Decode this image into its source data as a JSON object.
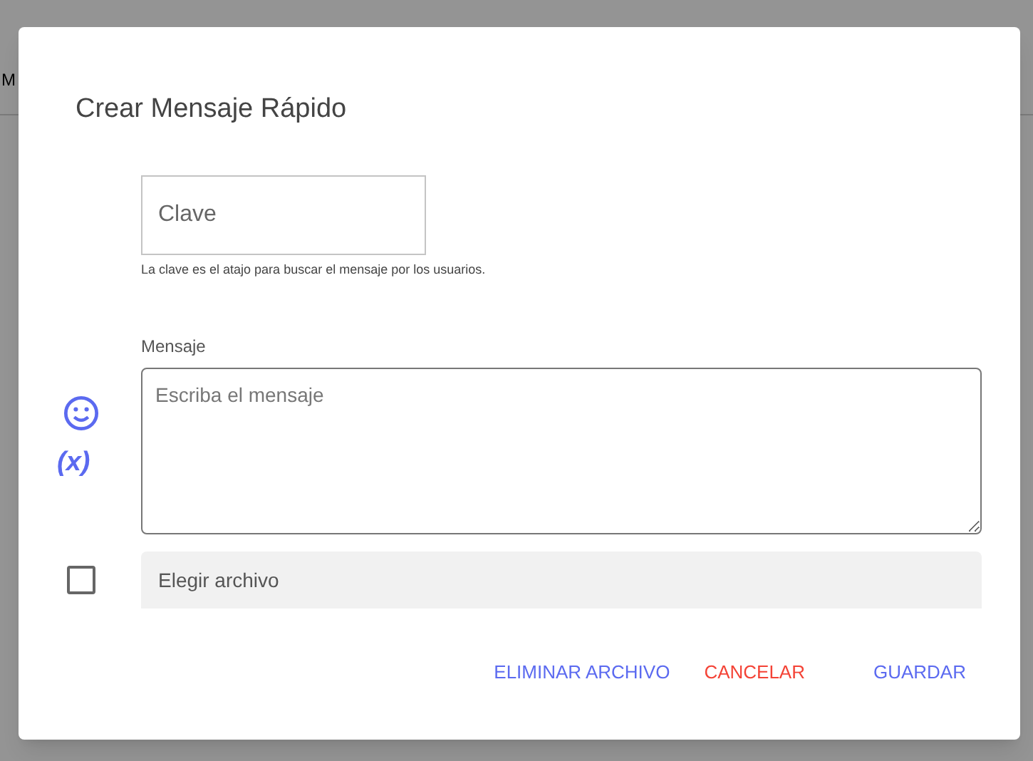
{
  "background": {
    "text": "M"
  },
  "dialog": {
    "title": "Crear Mensaje Rápido",
    "key_field": {
      "placeholder": "Clave",
      "hint": "La clave es el atajo para buscar el mensaje por los usuarios."
    },
    "message_field": {
      "label": "Mensaje",
      "placeholder": "Escriba el mensaje"
    },
    "variable_button": "(x)",
    "attachment": {
      "checked": false,
      "label": "Elegir archivo"
    },
    "buttons": [
      {
        "label": "ELIMINAR ARCHIVO",
        "kind": "primary"
      },
      {
        "label": "CANCELAR",
        "kind": "danger"
      },
      {
        "label": "GUARDAR",
        "kind": "primary"
      }
    ]
  }
}
